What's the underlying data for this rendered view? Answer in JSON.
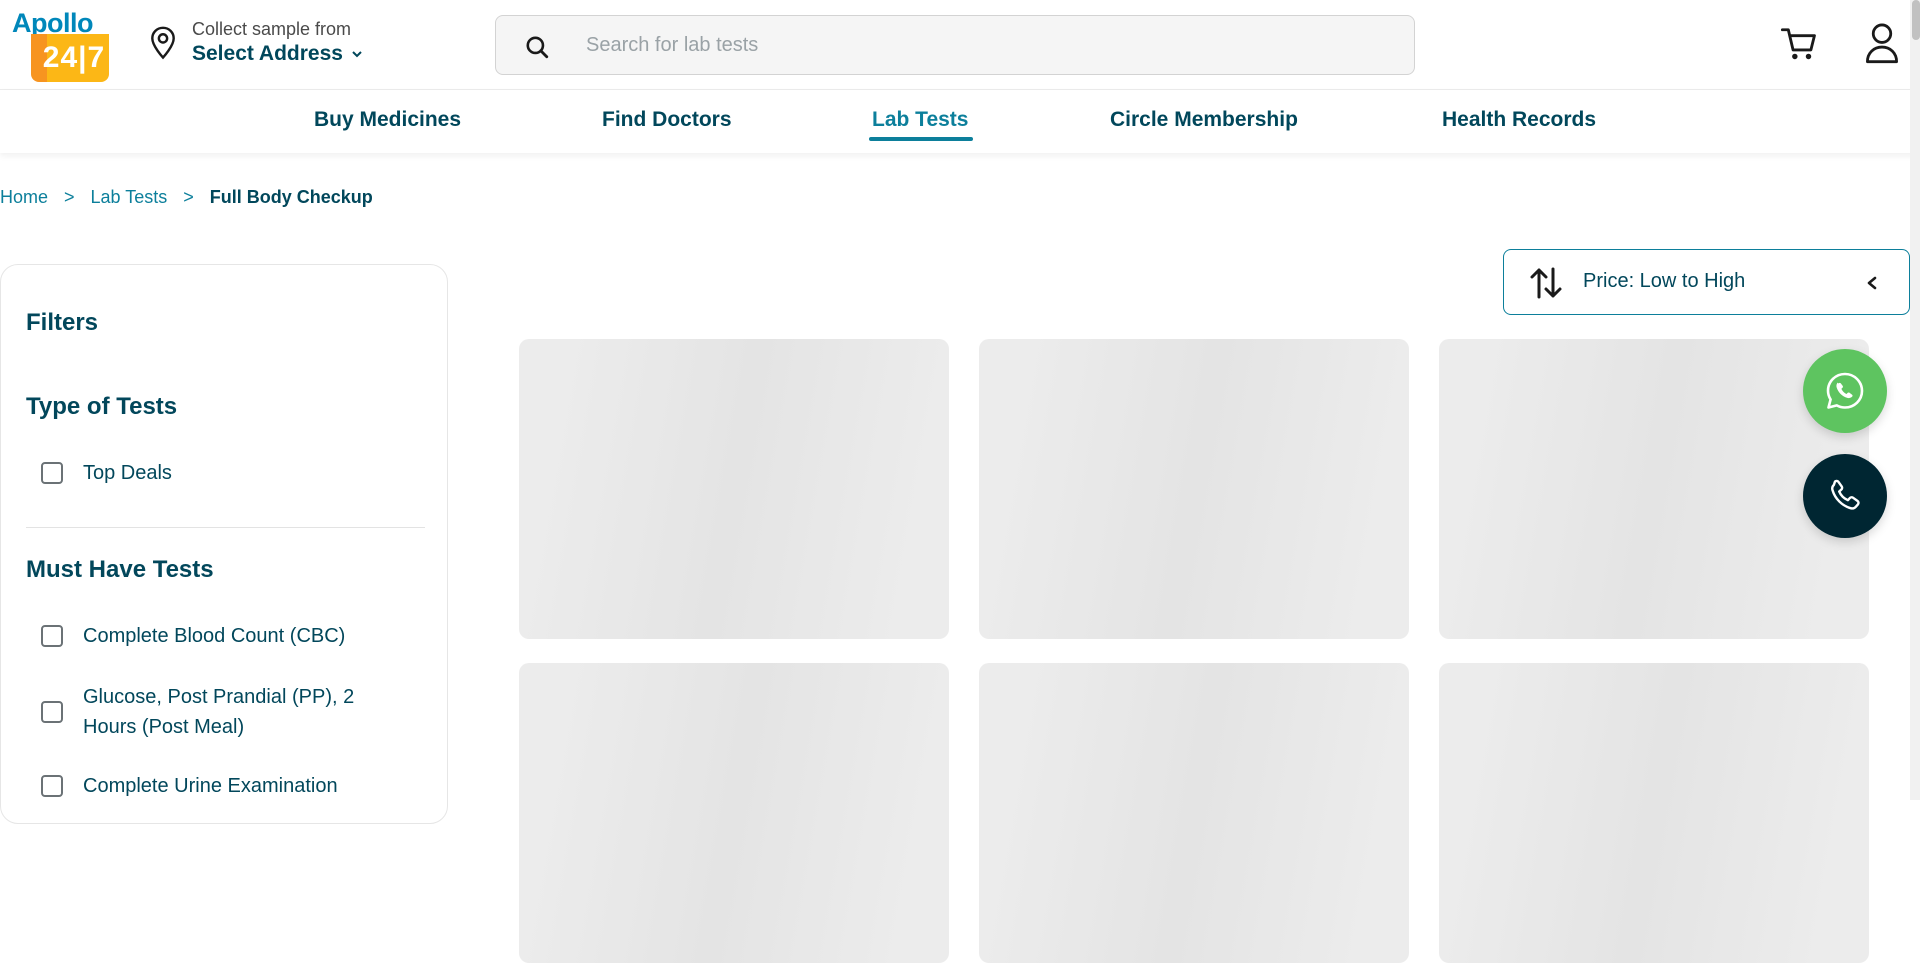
{
  "header": {
    "logo_text": "Apollo",
    "logo_number": "24|7",
    "location_label": "Collect sample from",
    "location_value": "Select Address",
    "search_placeholder": "Search for lab tests"
  },
  "nav": {
    "items": [
      {
        "label": "Buy Medicines"
      },
      {
        "label": "Find Doctors"
      },
      {
        "label": "Lab Tests"
      },
      {
        "label": "Circle Membership"
      },
      {
        "label": "Health Records"
      }
    ],
    "active": "Lab Tests"
  },
  "breadcrumb": {
    "items": [
      "Home",
      "Lab Tests",
      "Full Body Checkup"
    ],
    "separator": ">"
  },
  "filters": {
    "title": "Filters",
    "type_section": {
      "title": "Type of Tests",
      "options": [
        "Top Deals"
      ]
    },
    "must_have_section": {
      "title": "Must Have Tests",
      "options": [
        "Complete Blood Count (CBC)",
        "Glucose, Post Prandial (PP), 2 Hours (Post Meal)",
        "Complete Urine Examination"
      ]
    }
  },
  "sort": {
    "label": "Price: Low to High"
  },
  "colors": {
    "brand_teal": "#0c7f9b",
    "text_dark": "#02475b",
    "logo_orange": "#f79420",
    "whatsapp_green": "#5ec460",
    "call_dark": "#002632"
  },
  "icons": [
    "location-pin-icon",
    "chevron-down-icon",
    "search-icon",
    "cart-icon",
    "user-icon",
    "sort-arrows-icon",
    "chevron-left-icon",
    "whatsapp-icon",
    "phone-icon"
  ]
}
